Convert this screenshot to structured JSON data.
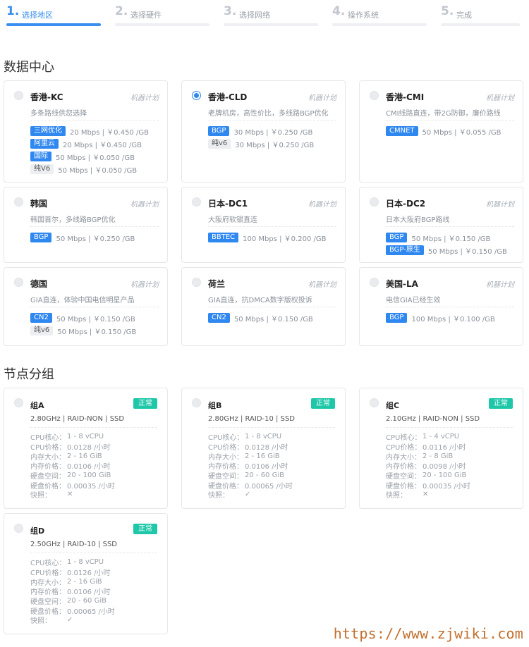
{
  "steps": [
    {
      "num": "1.",
      "label": "选择地区",
      "active": true
    },
    {
      "num": "2.",
      "label": "选择硬件",
      "active": false
    },
    {
      "num": "3.",
      "label": "选择网络",
      "active": false
    },
    {
      "num": "4.",
      "label": "操作系统",
      "active": false
    },
    {
      "num": "5.",
      "label": "完成",
      "active": false
    }
  ],
  "datacenter_title": "数据中心",
  "datacenters": [
    {
      "name": "香港-KC",
      "plan": "机器计划",
      "desc": "多条路线供您选择",
      "checked": false,
      "lines": [
        {
          "tag": "三网优化",
          "price": "20 Mbps | ￥0.450 /GB",
          "gray": false
        },
        {
          "tag": "阿里云",
          "price": "20 Mbps | ￥0.450 /GB",
          "gray": false
        },
        {
          "tag": "国际",
          "price": "50 Mbps | ￥0.050 /GB",
          "gray": false
        },
        {
          "tag": "纯V6",
          "price": "50 Mbps | ￥0.050 /GB",
          "gray": true
        }
      ]
    },
    {
      "name": "香港-CLD",
      "plan": "机器计划",
      "desc": "老牌机房，高性价比，多线路BGP优化",
      "checked": true,
      "lines": [
        {
          "tag": "BGP",
          "price": "30 Mbps | ￥0.250 /GB",
          "gray": false
        },
        {
          "tag": "纯v6",
          "price": "30 Mbps | ￥0.250 /GB",
          "gray": true
        }
      ]
    },
    {
      "name": "香港-CMI",
      "plan": "机器计划",
      "desc": "CMI线路直连，带2G防御，廉价路线",
      "checked": false,
      "lines": [
        {
          "tag": "CMNET",
          "price": "50 Mbps | ￥0.055 /GB",
          "gray": false
        }
      ]
    },
    {
      "name": "韩国",
      "plan": "机器计划",
      "desc": "韩国首尔，多线路BGP优化",
      "checked": false,
      "lines": [
        {
          "tag": "BGP",
          "price": "50 Mbps | ￥0.250 /GB",
          "gray": false
        }
      ]
    },
    {
      "name": "日本-DC1",
      "plan": "机器计划",
      "desc": "大阪府软银直连",
      "checked": false,
      "lines": [
        {
          "tag": "BBTEC",
          "price": "100 Mbps | ￥0.200 /GB",
          "gray": false
        }
      ]
    },
    {
      "name": "日本-DC2",
      "plan": "机器计划",
      "desc": "日本大阪府BGP路线",
      "checked": false,
      "lines": [
        {
          "tag": "BGP",
          "price": "50 Mbps | ￥0.150 /GB",
          "gray": false
        },
        {
          "tag": "BGP-原生",
          "price": "50 Mbps | ￥0.150 /GB",
          "gray": false
        }
      ]
    },
    {
      "name": "德国",
      "plan": "机器计划",
      "desc": "GIA直连，体验中国电信明星产品",
      "checked": false,
      "lines": [
        {
          "tag": "CN2",
          "price": "50 Mbps | ￥0.150 /GB",
          "gray": false
        },
        {
          "tag": "纯v6",
          "price": "50 Mbps | ￥0.150 /GB",
          "gray": true
        }
      ]
    },
    {
      "name": "荷兰",
      "plan": "机器计划",
      "desc": "GIA直连，抗DMCA数字版权投诉",
      "checked": false,
      "lines": [
        {
          "tag": "CN2",
          "price": "50 Mbps | ￥0.150 /GB",
          "gray": false
        }
      ]
    },
    {
      "name": "美国-LA",
      "plan": "机器计划",
      "desc": "电信GIA已经生效",
      "checked": false,
      "lines": [
        {
          "tag": "BGP",
          "price": "100 Mbps | ￥0.100 /GB",
          "gray": false
        }
      ]
    }
  ],
  "group_title": "节点分组",
  "group_labels": {
    "cpu_cores": "CPU核心：",
    "cpu_price": "CPU价格：",
    "mem_size": "内存大小：",
    "mem_price": "内存价格：",
    "disk_space": "硬盘空间：",
    "disk_price": "硬盘价格：",
    "snapshot": "快照："
  },
  "groups": [
    {
      "name": "组A",
      "status": "正常",
      "spec": "2.80GHz | RAID-NON | SSD",
      "cpu_cores": "1 - 8 vCPU",
      "cpu_price": "0.0128 /小时",
      "mem_size": "2 - 16 GiB",
      "mem_price": "0.0106 /小时",
      "disk_space": "20 - 100 GiB",
      "disk_price": "0.00035 /小时",
      "snapshot": "✕",
      "snapshot_icon": "cross-icon"
    },
    {
      "name": "组B",
      "status": "正常",
      "spec": "2.80GHz | RAID-10 | SSD",
      "cpu_cores": "1 - 8 vCPU",
      "cpu_price": "0.0128 /小时",
      "mem_size": "2 - 16 GiB",
      "mem_price": "0.0106 /小时",
      "disk_space": "20 - 60 GiB",
      "disk_price": "0.00065 /小时",
      "snapshot": "✓",
      "snapshot_icon": "check-icon"
    },
    {
      "name": "组C",
      "status": "正常",
      "spec": "2.10GHz | RAID-NON | SSD",
      "cpu_cores": "1 - 4 vCPU",
      "cpu_price": "0.0116 /小时",
      "mem_size": "2 - 8 GiB",
      "mem_price": "0.0098 /小时",
      "disk_space": "20 - 100 GiB",
      "disk_price": "0.00035 /小时",
      "snapshot": "✕",
      "snapshot_icon": "cross-icon"
    },
    {
      "name": "组D",
      "status": "正常",
      "spec": "2.50GHz | RAID-10 | SSD",
      "cpu_cores": "1 - 8 vCPU",
      "cpu_price": "0.0126 /小时",
      "mem_size": "2 - 16 GiB",
      "mem_price": "0.0106 /小时",
      "disk_space": "20 - 60 GiB",
      "disk_price": "0.00065 /小时",
      "snapshot": "✓",
      "snapshot_icon": "check-icon"
    }
  ],
  "watermark": "https://www.zjwiki.com",
  "colors": {
    "accent": "#2f87f0",
    "status_ok": "#1ec7a8",
    "watermark": "#c2702f"
  }
}
